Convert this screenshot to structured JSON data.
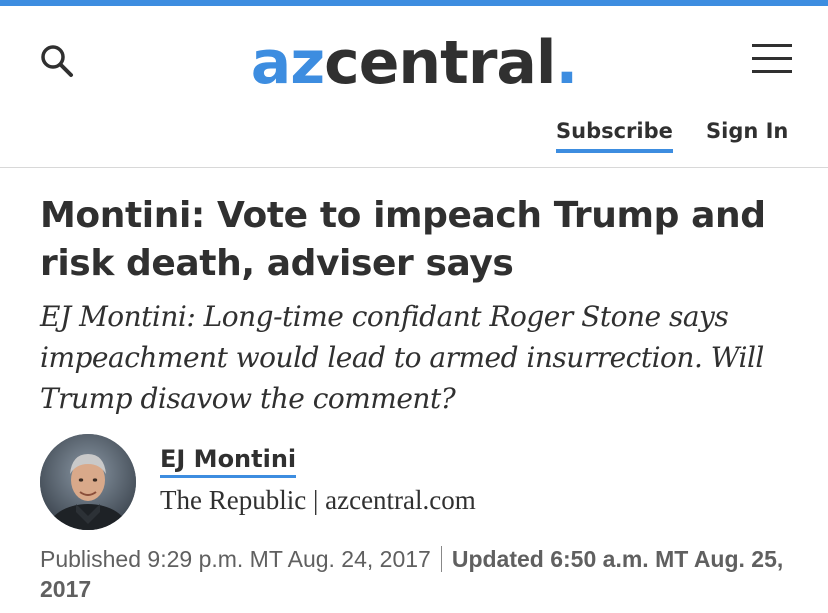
{
  "header": {
    "logo_az": "az",
    "logo_central": "central",
    "logo_dot": ".",
    "subscribe_label": "Subscribe",
    "signin_label": "Sign In",
    "search_icon": "search-icon",
    "menu_icon": "hamburger-menu-icon"
  },
  "article": {
    "headline": "Montini: Vote to impeach Trump and risk death, adviser says",
    "summary": "EJ Montini: Long-time confidant Roger Stone says impeachment would lead to armed insurrection. Will Trump disavow the comment?",
    "author_name": "EJ Montini",
    "author_affiliation": "The Republic | azcentral.com",
    "published": "Published 9:29 p.m. MT Aug. 24, 2017",
    "updated": "Updated 6:50 a.m. MT Aug. 25, 2017"
  },
  "colors": {
    "accent": "#3d8de0",
    "text": "#303030",
    "meta_text": "#606060"
  }
}
